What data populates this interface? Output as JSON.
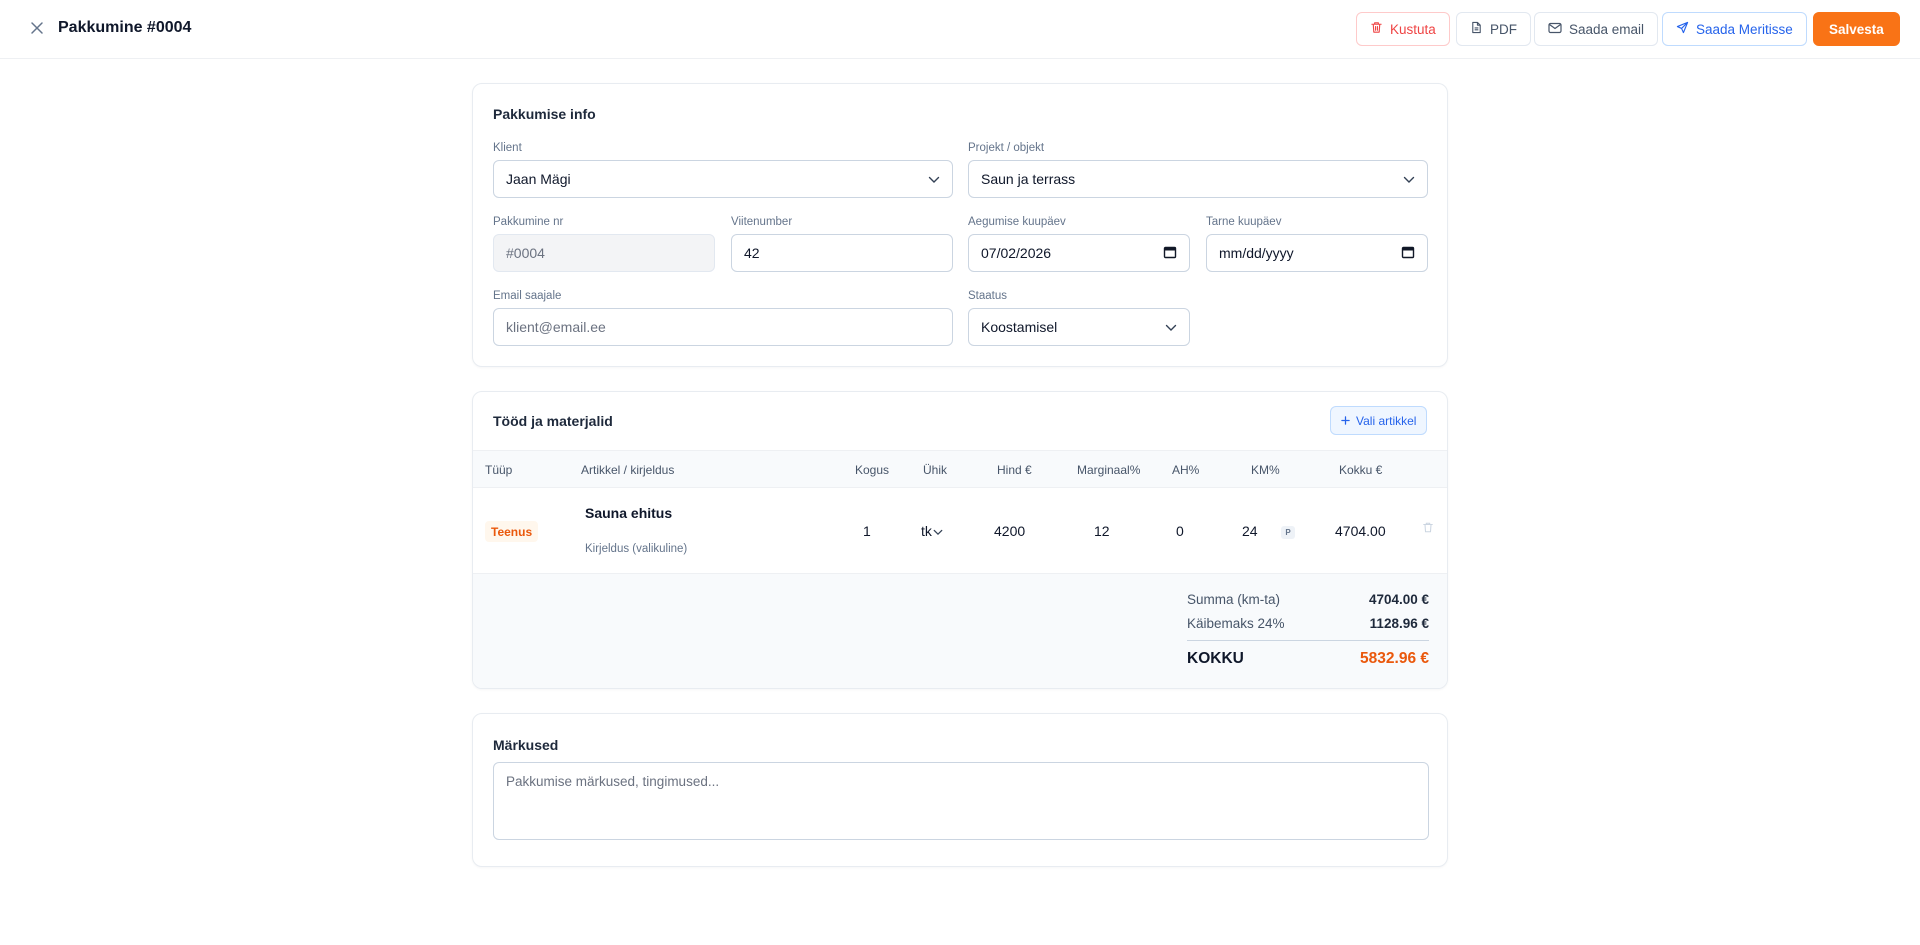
{
  "header": {
    "title": "Pakkumine #0004",
    "delete_label": "Kustuta",
    "pdf_label": "PDF",
    "email_label": "Saada email",
    "meritisse_label": "Saada Meritisse",
    "save_label": "Salvesta"
  },
  "info": {
    "title": "Pakkumise info",
    "client_label": "Klient",
    "client_value": "Jaan Mägi",
    "project_label": "Projekt / objekt",
    "project_value": "Saun ja terrass",
    "number_label": "Pakkumine nr",
    "number_value": "#0004",
    "reference_label": "Viitenumber",
    "reference_value": "42",
    "expiry_label": "Aegumise kuupäev",
    "expiry_value": "07/02/2026",
    "delivery_label": "Tarne kuupäev",
    "delivery_value": "mm/dd/yyyy",
    "email_label": "Email saajale",
    "email_placeholder": "klient@email.ee",
    "status_label": "Staatus",
    "status_value": "Koostamisel"
  },
  "works": {
    "title": "Tööd ja materjalid",
    "add_label": "Vali artikkel",
    "columns": [
      "Tüüp",
      "Artikkel / kirjeldus",
      "Kogus",
      "Ühik",
      "Hind €",
      "Marginaal%",
      "AH%",
      "KM%",
      "Kokku €"
    ],
    "rows": [
      {
        "type": "Teenus",
        "name": "Sauna ehitus",
        "description_placeholder": "Kirjeldus (valikuline)",
        "qty": "1",
        "unit": "tk",
        "price": "4200",
        "margin": "12",
        "ah": "0",
        "vat": "24",
        "vat_badge": "P",
        "total": "4704.00"
      }
    ],
    "totals": {
      "subtotal_label": "Summa (km-ta)",
      "subtotal_value": "4704.00 €",
      "vat_label": "Käibemaks 24%",
      "vat_value": "1128.96 €",
      "grand_label": "KOKKU",
      "grand_value": "5832.96 €"
    }
  },
  "notes": {
    "title": "Märkused",
    "placeholder": "Pakkumise märkused, tingimused..."
  },
  "colors": {
    "accent": "#f97316",
    "danger": "#ef4444",
    "link": "#2563eb",
    "grand_total": "#ea580c"
  }
}
